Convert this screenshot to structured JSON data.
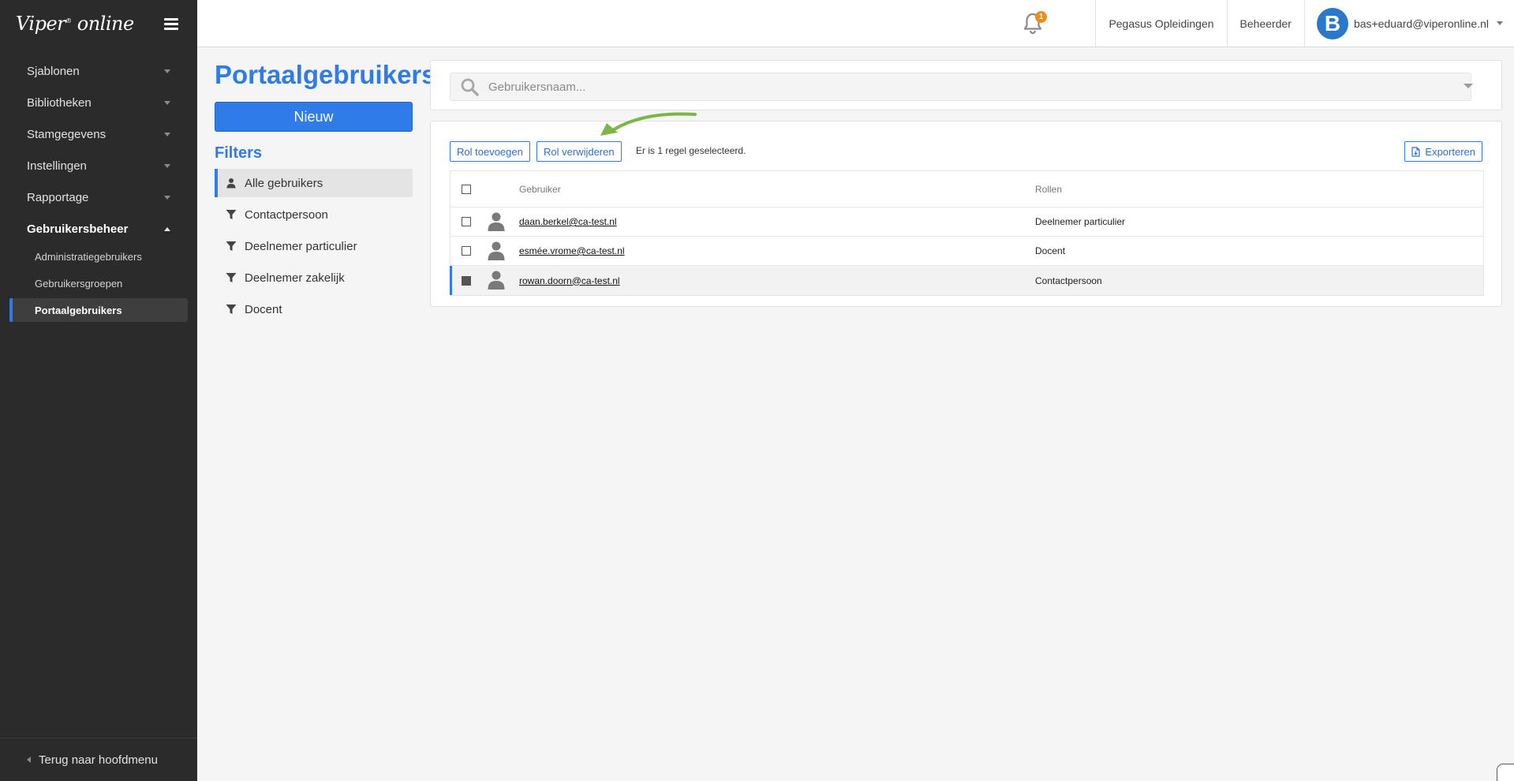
{
  "brand": {
    "logo_text": "Viper",
    "logo_sup": "®",
    "logo_suffix": " online"
  },
  "sidebar": {
    "items": [
      {
        "label": "Sjablonen"
      },
      {
        "label": "Bibliotheken"
      },
      {
        "label": "Stamgegevens"
      },
      {
        "label": "Instellingen"
      },
      {
        "label": "Rapportage"
      },
      {
        "label": "Gebruikersbeheer"
      }
    ],
    "subitems": [
      {
        "label": "Administratiegebruikers"
      },
      {
        "label": "Gebruikersgroepen"
      },
      {
        "label": "Portaalgebruikers"
      }
    ],
    "footer": "Terug naar hoofdmenu"
  },
  "header": {
    "notification_count": "1",
    "organization": "Pegasus Opleidingen",
    "role": "Beheerder",
    "avatar_letter": "B",
    "user_email": "bas+eduard@viperonline.nl"
  },
  "page": {
    "title": "Portaalgebruikers",
    "new_button": "Nieuw",
    "filters_title": "Filters",
    "filters": [
      {
        "label": "Alle gebruikers",
        "icon": "user-icon"
      },
      {
        "label": "Contactpersoon",
        "icon": "filter-icon"
      },
      {
        "label": "Deelnemer particulier",
        "icon": "filter-icon"
      },
      {
        "label": "Deelnemer zakelijk",
        "icon": "filter-icon"
      },
      {
        "label": "Docent",
        "icon": "filter-icon"
      }
    ]
  },
  "search": {
    "placeholder": "Gebruikersnaam..."
  },
  "toolbar": {
    "add_role": "Rol toevoegen",
    "remove_role": "Rol verwijderen",
    "selection_text": "Er is 1 regel geselecteerd.",
    "export": "Exporteren"
  },
  "table": {
    "headers": {
      "user": "Gebruiker",
      "roles": "Rollen"
    },
    "rows": [
      {
        "user": "daan.berkel@ca-test.nl",
        "role": "Deelnemer particulier",
        "selected": false
      },
      {
        "user": "esmée.vrome@ca-test.nl",
        "role": "Docent",
        "selected": false
      },
      {
        "user": "rowan.doorn@ca-test.nl",
        "role": "Contactpersoon",
        "selected": true
      }
    ]
  },
  "colors": {
    "accent": "#2f7be8",
    "sidebar_bg": "#2b2b2b",
    "badge": "#f28b1f",
    "arrow": "#7ab648"
  }
}
